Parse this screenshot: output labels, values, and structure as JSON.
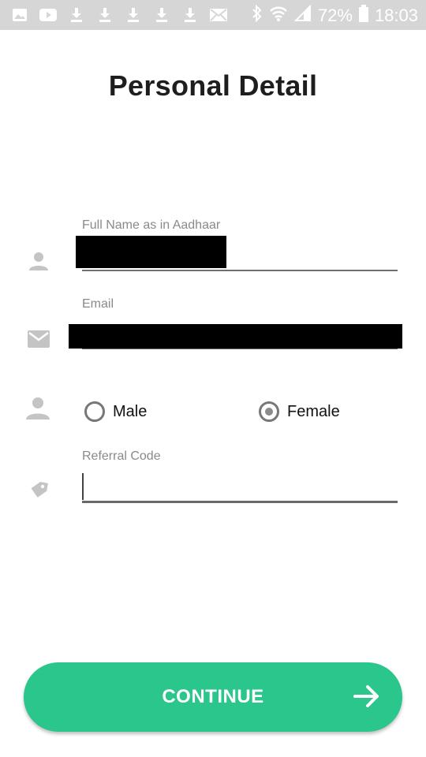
{
  "status_bar": {
    "battery_percent": "72%",
    "time": "18:03",
    "icons": [
      "image-icon",
      "youtube-icon",
      "download-icon",
      "download-icon",
      "download-icon",
      "download-icon",
      "download-icon",
      "mail-icon",
      "bluetooth-icon",
      "wifi-icon",
      "signal-icon",
      "battery-icon"
    ]
  },
  "page": {
    "title": "Personal Detail"
  },
  "form": {
    "full_name_label": "Full Name as in Aadhaar",
    "email_label": "Email",
    "gender_options": [
      {
        "label": "Male",
        "selected": false
      },
      {
        "label": "Female",
        "selected": true
      }
    ],
    "referral_label": "Referral Code",
    "referral_value": ""
  },
  "footer": {
    "continue_label": "CONTINUE"
  },
  "colors": {
    "accent": "#2ac68c",
    "statusbar": "#d6d6d6",
    "icon_gray": "#c4c4c4"
  }
}
